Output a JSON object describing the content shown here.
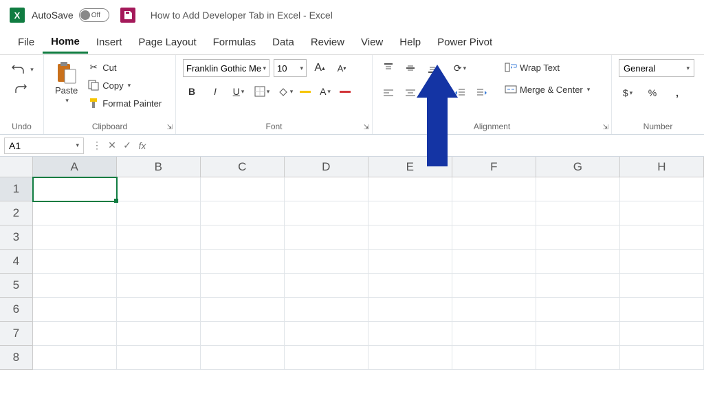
{
  "title": "How to Add Developer Tab in Excel  -  Excel",
  "autosave": {
    "label": "AutoSave",
    "state": "Off"
  },
  "tabs": [
    "File",
    "Home",
    "Insert",
    "Page Layout",
    "Formulas",
    "Data",
    "Review",
    "View",
    "Help",
    "Power Pivot"
  ],
  "active_tab": "Home",
  "ribbon": {
    "undo": {
      "label": "Undo"
    },
    "clipboard": {
      "label": "Clipboard",
      "paste": "Paste",
      "cut": "Cut",
      "copy": "Copy",
      "format_painter": "Format Painter"
    },
    "font": {
      "label": "Font",
      "name": "Franklin Gothic Me",
      "size": "10"
    },
    "alignment": {
      "label": "Alignment",
      "wrap": "Wrap Text",
      "merge": "Merge & Center"
    },
    "number": {
      "label": "Number",
      "format": "General"
    }
  },
  "name_box": "A1",
  "columns": [
    "A",
    "B",
    "C",
    "D",
    "E",
    "F",
    "G",
    "H"
  ],
  "rows": [
    "1",
    "2",
    "3",
    "4",
    "5",
    "6",
    "7",
    "8"
  ],
  "active_cell": "A1"
}
